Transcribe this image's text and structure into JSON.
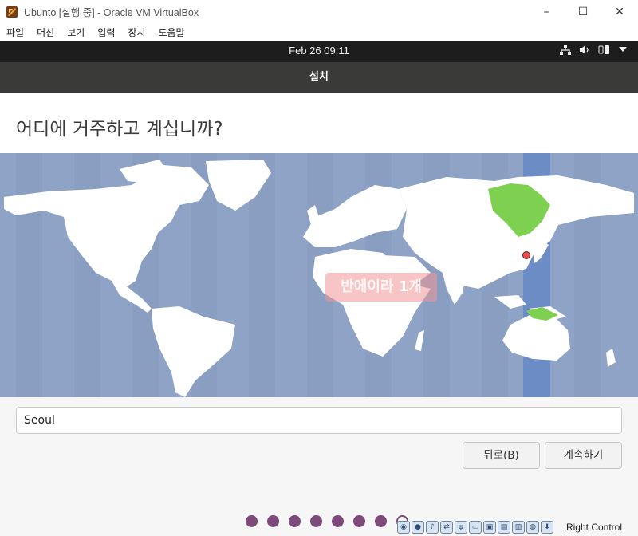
{
  "window": {
    "title": "Ubunto [실행 중] - Oracle VM VirtualBox",
    "controls": {
      "minimize": "–",
      "maximize": "☐",
      "close": "✕"
    }
  },
  "menu": [
    "파일",
    "머신",
    "보기",
    "입력",
    "장치",
    "도움말"
  ],
  "guest_panel": {
    "clock": "Feb 26  09:11",
    "icons": [
      "network-icon",
      "volume-icon",
      "battery-icon",
      "dropdown-arrow-icon"
    ]
  },
  "installer": {
    "title": "설치",
    "question": "어디에 거주하고 계십니까?",
    "location_value": "Seoul",
    "back_label": "뒤로(B)",
    "continue_label": "계속하기"
  },
  "map": {
    "highlight_timezone": "Asia/Seoul",
    "watermark": "반에이라 1개",
    "colors": {
      "ocean": "#8fa3c6",
      "land": "#ffffff",
      "timezone_band": "#6b8cc4",
      "selected_region": "#7ed051",
      "marker": "#e84c4c"
    }
  },
  "progress": {
    "completed_steps": 7,
    "current_step": 8
  },
  "statusbar": {
    "host_key": "Right Control",
    "icons": [
      "hdd-icon",
      "optical-icon",
      "audio-icon",
      "network-adapter-icon",
      "usb-icon",
      "shared-folder-icon",
      "display-icon",
      "recording-icon",
      "cpu-icon",
      "mouse-integration-icon",
      "arrow-down-icon"
    ]
  }
}
